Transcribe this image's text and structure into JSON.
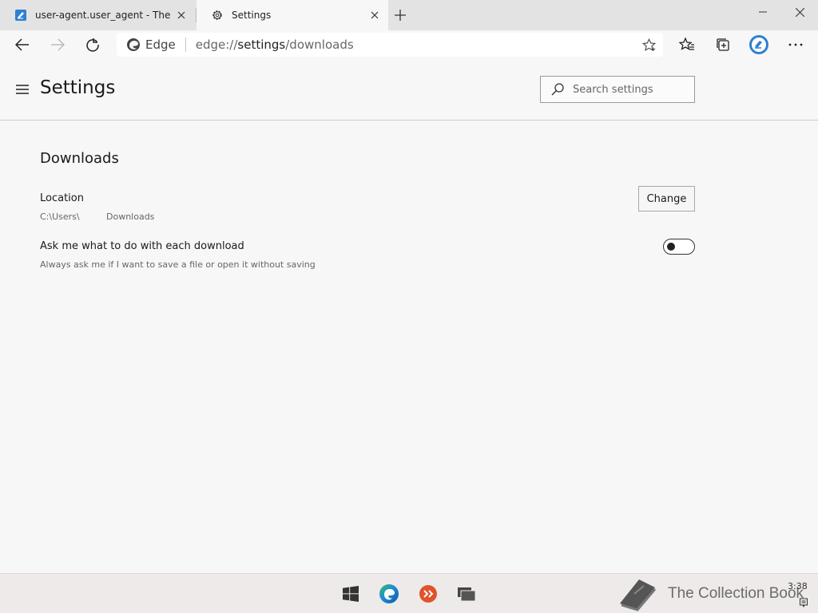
{
  "tabs": [
    {
      "title": "user-agent.user_agent - The Coll",
      "icon": "collection-book-icon"
    },
    {
      "title": "Settings",
      "icon": "gear-icon"
    }
  ],
  "address_bar": {
    "site_label": "Edge",
    "url_scheme": "edge://",
    "url_host": "settings",
    "url_path": "/downloads"
  },
  "header": {
    "title": "Settings",
    "search_placeholder": "Search settings"
  },
  "downloads": {
    "title": "Downloads",
    "location_label": "Location",
    "location_path_1": "C:\\Users\\",
    "location_path_2": "Downloads",
    "change_label": "Change",
    "ask_label": "Ask me what to do with each download",
    "ask_sub": "Always ask me if I want to save a file or open it without saving",
    "ask_enabled": false
  },
  "taskbar": {
    "brand_text": "The Collection Book",
    "clock": "3:38"
  },
  "colors": {
    "accent_blue": "#2f7fd1",
    "edge_blue": "#1e86d8",
    "edge_green": "#37c06a",
    "app_orange": "#e0532b"
  }
}
